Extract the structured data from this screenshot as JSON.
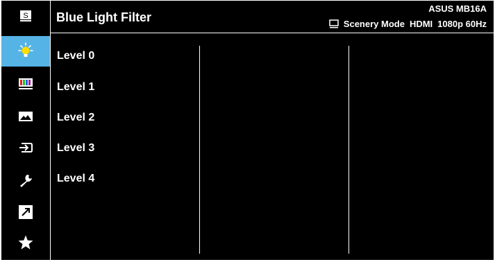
{
  "header": {
    "title": "Blue Light Filter",
    "model": "ASUS MB16A",
    "mode": "Scenery Mode",
    "input": "HDMI",
    "resolution": "1080p 60Hz"
  },
  "sidebar": {
    "items": [
      {
        "name": "splendid",
        "icon": "s-icon",
        "glyph": "S"
      },
      {
        "name": "blue-light-filter",
        "icon": "lightbulb-icon",
        "active": true
      },
      {
        "name": "color",
        "icon": "color-bars-icon"
      },
      {
        "name": "image",
        "icon": "landscape-icon"
      },
      {
        "name": "input-select",
        "icon": "input-icon"
      },
      {
        "name": "system-setup",
        "icon": "wrench-icon"
      },
      {
        "name": "shortcut",
        "icon": "shortcut-arrow-icon"
      },
      {
        "name": "myfavorite",
        "icon": "star-icon"
      }
    ]
  },
  "menu": {
    "levels": [
      "Level 0",
      "Level 1",
      "Level 2",
      "Level 3",
      "Level 4"
    ]
  },
  "colors": {
    "background": "#000000",
    "accent": "#56b3e6",
    "text": "#ffffff"
  }
}
